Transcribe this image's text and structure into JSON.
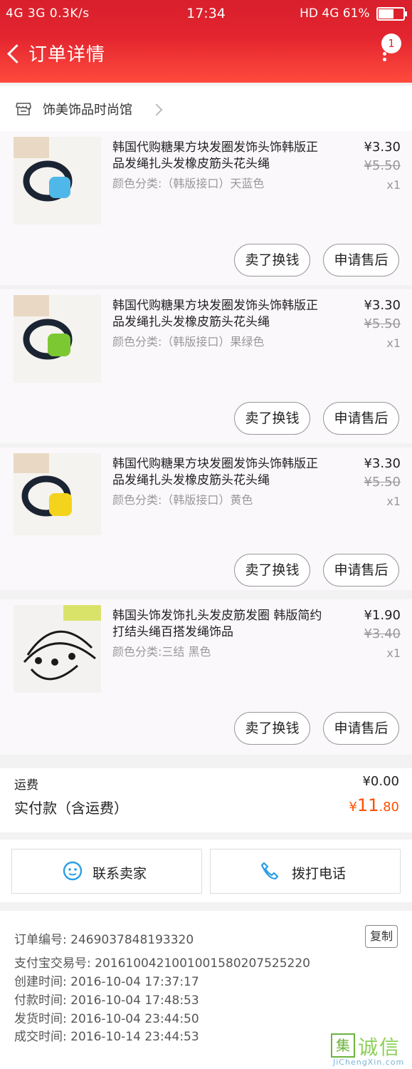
{
  "status_bar": {
    "left": "4G  3G  0.3K/s",
    "time": "17:34",
    "right": "HD 4G 61%"
  },
  "header": {
    "title": "订单详情",
    "badge_count": "1"
  },
  "store": {
    "name": "饰美饰品时尚馆"
  },
  "items": [
    {
      "title": "韩国代购糖果方块发圈发饰头饰韩版正品发绳扎头发橡皮筋头花头绳",
      "spec": "颜色分类:（韩版接口）天蓝色",
      "price": "¥3.30",
      "original_price": "¥5.50",
      "qty": "x1",
      "bead_color": "#4fb8e8",
      "btn_sell": "卖了换钱",
      "btn_after": "申请售后"
    },
    {
      "title": "韩国代购糖果方块发圈发饰头饰韩版正品发绳扎头发橡皮筋头花头绳",
      "spec": "颜色分类:（韩版接口）果绿色",
      "price": "¥3.30",
      "original_price": "¥5.50",
      "qty": "x1",
      "bead_color": "#7cc832",
      "btn_sell": "卖了换钱",
      "btn_after": "申请售后"
    },
    {
      "title": "韩国代购糖果方块发圈发饰头饰韩版正品发绳扎头发橡皮筋头花头绳",
      "spec": "颜色分类:（韩版接口）黄色",
      "price": "¥3.30",
      "original_price": "¥5.50",
      "qty": "x1",
      "bead_color": "#f4d31c",
      "btn_sell": "卖了换钱",
      "btn_after": "申请售后"
    },
    {
      "title": "韩国头饰发饰扎头发皮筋发圈 韩版简约打结头绳百搭发绳饰品",
      "spec": "颜色分类:三结 黑色",
      "price": "¥1.90",
      "original_price": "¥3.40",
      "qty": "x1",
      "bead_color": "#1a1a1a",
      "btn_sell": "卖了换钱",
      "btn_after": "申请售后"
    }
  ],
  "totals": {
    "shipping_label": "运费",
    "shipping_value": "¥0.00",
    "paid_label": "实付款（含运费）",
    "paid_currency": "¥",
    "paid_int": "11",
    "paid_dec": ".80"
  },
  "contact": {
    "seller": "联系卖家",
    "phone": "拨打电话"
  },
  "order_info": {
    "order_no": "订单编号: 2469037848193320",
    "copy": "复制",
    "alipay_no": "支付宝交易号: 2016100421001001580207525220",
    "created": "创建时间: 2016-10-04 17:37:17",
    "paid": "付款时间: 2016-10-04 17:48:53",
    "shipped": "发货时间: 2016-10-04 23:44:50",
    "completed": "成交时间: 2016-10-14 23:44:53"
  },
  "watermark": {
    "box": "集",
    "text": "诚信",
    "sub": "JiChengXin.com"
  },
  "colors": {
    "header_red": "#e3252f",
    "price_orange": "#ff5000"
  }
}
